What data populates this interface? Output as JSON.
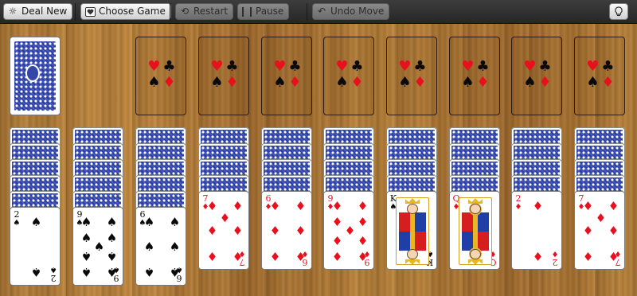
{
  "toolbar": {
    "deal_new": {
      "label": "Deal New",
      "icon": "sun-icon"
    },
    "choose_game": {
      "label": "Choose Game",
      "icon": "heart-card-icon"
    },
    "restart": {
      "label": "Restart",
      "icon": "restart-icon"
    },
    "pause": {
      "label": "Pause",
      "icon": "pause-icon"
    },
    "undo_move": {
      "label": "Undo Move",
      "icon": "undo-icon"
    },
    "hint": {
      "icon": "lightbulb-icon"
    }
  },
  "foundation_slot_suits": [
    "♥",
    "♣",
    "♠",
    "♦"
  ],
  "foundation_slot_colors": [
    "red",
    "blk",
    "blk",
    "red"
  ],
  "foundation_count": 8,
  "tableau": [
    {
      "hidden": 5,
      "face": {
        "rank": "2",
        "suit": "♠",
        "color": "blk"
      }
    },
    {
      "hidden": 5,
      "face": {
        "rank": "9",
        "suit": "♠",
        "color": "blk"
      }
    },
    {
      "hidden": 5,
      "face": {
        "rank": "6",
        "suit": "♠",
        "color": "blk"
      }
    },
    {
      "hidden": 4,
      "face": {
        "rank": "7",
        "suit": "♦",
        "color": "red"
      }
    },
    {
      "hidden": 4,
      "face": {
        "rank": "6",
        "suit": "♦",
        "color": "red"
      }
    },
    {
      "hidden": 4,
      "face": {
        "rank": "9",
        "suit": "♦",
        "color": "red"
      }
    },
    {
      "hidden": 4,
      "face": {
        "rank": "K",
        "suit": "♠",
        "color": "blk"
      }
    },
    {
      "hidden": 4,
      "face": {
        "rank": "Q",
        "suit": "♦",
        "color": "red"
      }
    },
    {
      "hidden": 4,
      "face": {
        "rank": "2",
        "suit": "♦",
        "color": "red"
      }
    },
    {
      "hidden": 4,
      "face": {
        "rank": "7",
        "suit": "♦",
        "color": "red"
      }
    }
  ]
}
